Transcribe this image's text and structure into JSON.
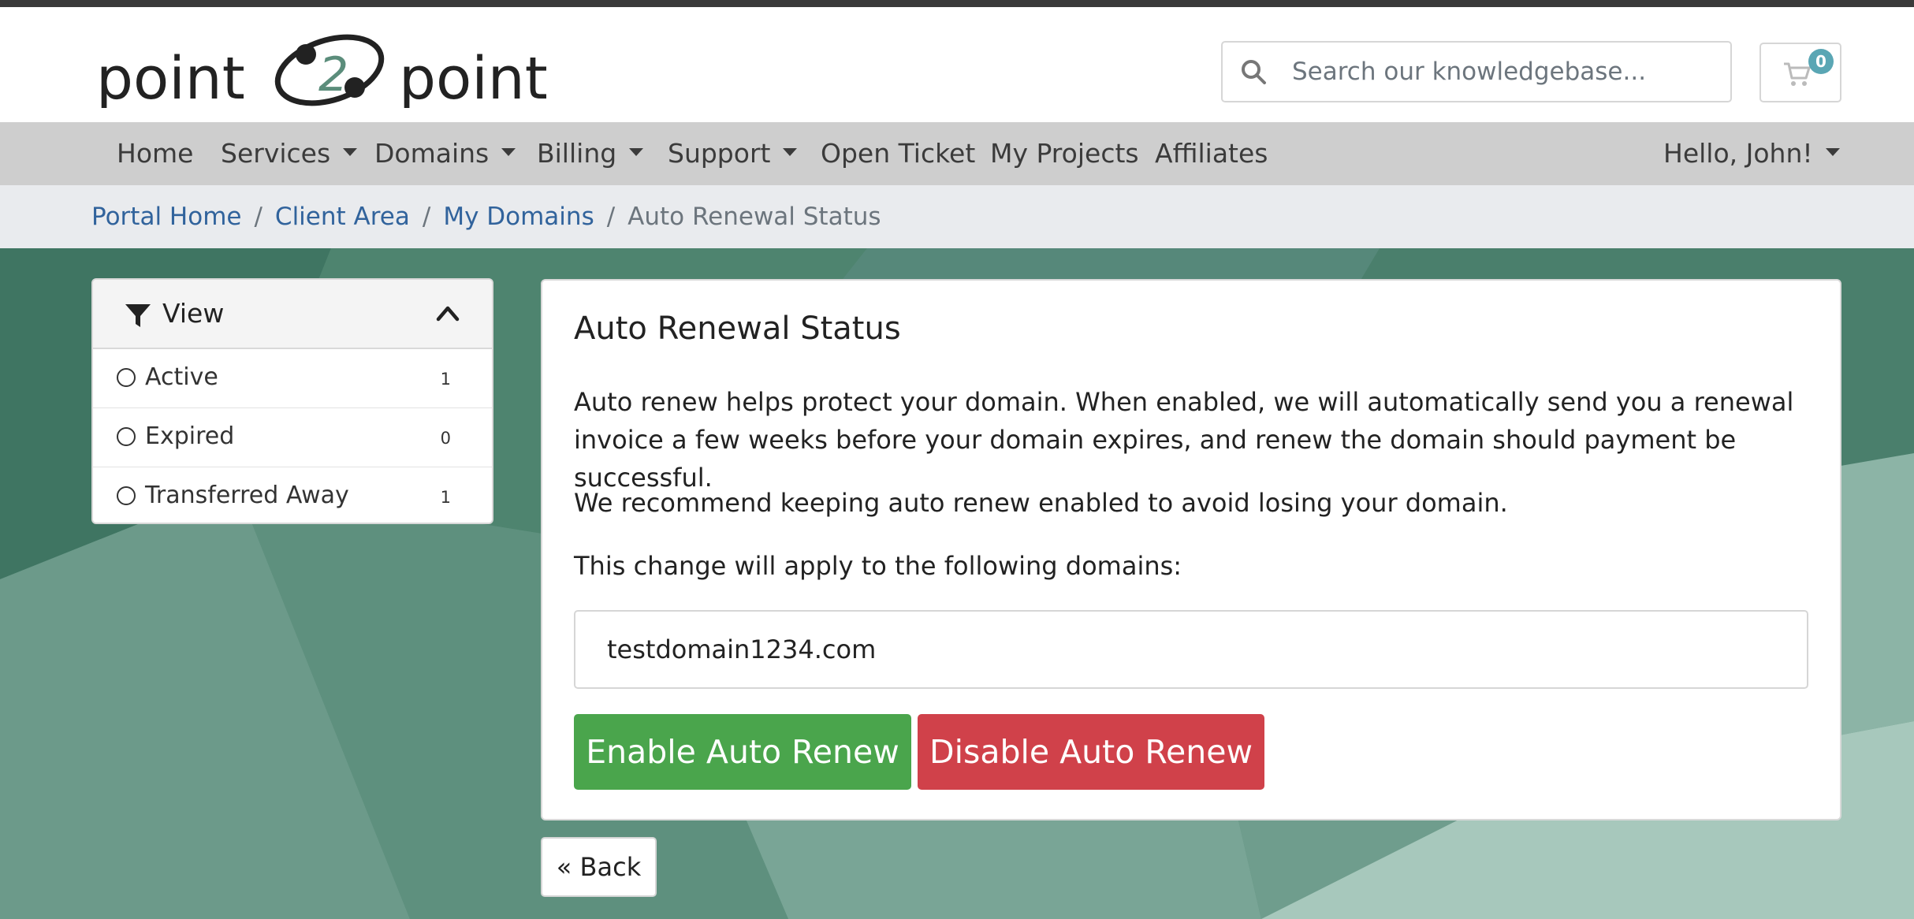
{
  "header": {
    "logo_text_left": "point",
    "logo_text_mid": "2",
    "logo_text_right": "point",
    "search_placeholder": "Search our knowledgebase...",
    "cart_count": "0"
  },
  "nav": {
    "items": [
      {
        "label": "Home",
        "dropdown": false
      },
      {
        "label": "Services",
        "dropdown": true
      },
      {
        "label": "Domains",
        "dropdown": true
      },
      {
        "label": "Billing",
        "dropdown": true
      },
      {
        "label": "Support",
        "dropdown": true
      },
      {
        "label": "Open Ticket",
        "dropdown": false
      },
      {
        "label": "My Projects",
        "dropdown": false
      },
      {
        "label": "Affiliates",
        "dropdown": false
      }
    ],
    "user_menu": "Hello, John!"
  },
  "breadcrumb": {
    "items": [
      "Portal Home",
      "Client Area",
      "My Domains"
    ],
    "current": "Auto Renewal Status",
    "separator": "/"
  },
  "sidebar": {
    "title": "View",
    "filters": [
      {
        "label": "Active",
        "count": "1"
      },
      {
        "label": "Expired",
        "count": "0"
      },
      {
        "label": "Transferred Away",
        "count": "1"
      }
    ]
  },
  "card": {
    "title": "Auto Renewal Status",
    "paragraph1": "Auto renew helps protect your domain. When enabled, we will automatically send you a renewal invoice a few weeks before your domain expires, and renew the domain should payment be successful.",
    "paragraph2": "We recommend keeping auto renew enabled to avoid losing your domain.",
    "paragraph3": "This change will apply to the following domains:",
    "domain": "testdomain1234.com",
    "enable_label": "Enable Auto Renew",
    "disable_label": "Disable Auto Renew"
  },
  "back_label": "« Back",
  "colors": {
    "enable": "#4aa54c",
    "disable": "#d0414a",
    "link": "#31639c",
    "background": "#5b8d7b",
    "badge": "#5aa6b4"
  }
}
